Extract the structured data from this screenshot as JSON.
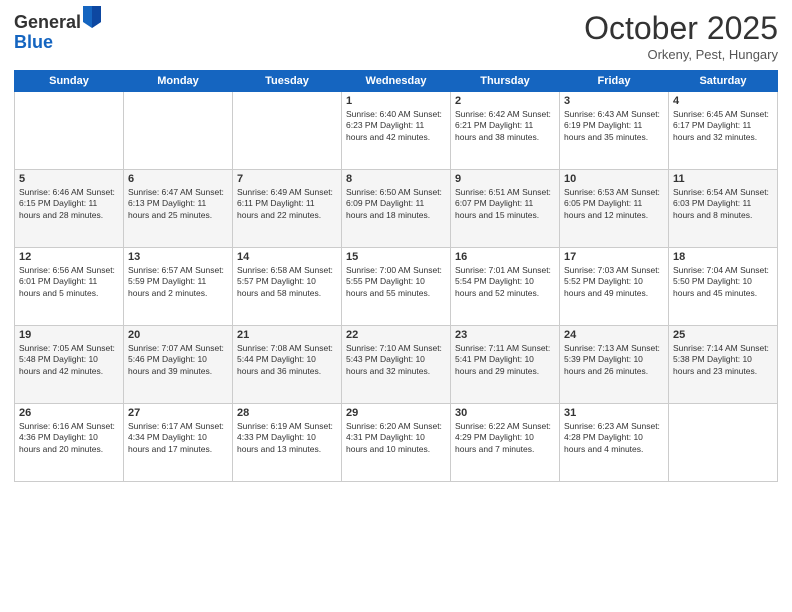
{
  "header": {
    "logo_general": "General",
    "logo_blue": "Blue",
    "month": "October 2025",
    "location": "Orkeny, Pest, Hungary"
  },
  "weekdays": [
    "Sunday",
    "Monday",
    "Tuesday",
    "Wednesday",
    "Thursday",
    "Friday",
    "Saturday"
  ],
  "weeks": [
    [
      {
        "day": "",
        "info": ""
      },
      {
        "day": "",
        "info": ""
      },
      {
        "day": "",
        "info": ""
      },
      {
        "day": "1",
        "info": "Sunrise: 6:40 AM\nSunset: 6:23 PM\nDaylight: 11 hours\nand 42 minutes."
      },
      {
        "day": "2",
        "info": "Sunrise: 6:42 AM\nSunset: 6:21 PM\nDaylight: 11 hours\nand 38 minutes."
      },
      {
        "day": "3",
        "info": "Sunrise: 6:43 AM\nSunset: 6:19 PM\nDaylight: 11 hours\nand 35 minutes."
      },
      {
        "day": "4",
        "info": "Sunrise: 6:45 AM\nSunset: 6:17 PM\nDaylight: 11 hours\nand 32 minutes."
      }
    ],
    [
      {
        "day": "5",
        "info": "Sunrise: 6:46 AM\nSunset: 6:15 PM\nDaylight: 11 hours\nand 28 minutes."
      },
      {
        "day": "6",
        "info": "Sunrise: 6:47 AM\nSunset: 6:13 PM\nDaylight: 11 hours\nand 25 minutes."
      },
      {
        "day": "7",
        "info": "Sunrise: 6:49 AM\nSunset: 6:11 PM\nDaylight: 11 hours\nand 22 minutes."
      },
      {
        "day": "8",
        "info": "Sunrise: 6:50 AM\nSunset: 6:09 PM\nDaylight: 11 hours\nand 18 minutes."
      },
      {
        "day": "9",
        "info": "Sunrise: 6:51 AM\nSunset: 6:07 PM\nDaylight: 11 hours\nand 15 minutes."
      },
      {
        "day": "10",
        "info": "Sunrise: 6:53 AM\nSunset: 6:05 PM\nDaylight: 11 hours\nand 12 minutes."
      },
      {
        "day": "11",
        "info": "Sunrise: 6:54 AM\nSunset: 6:03 PM\nDaylight: 11 hours\nand 8 minutes."
      }
    ],
    [
      {
        "day": "12",
        "info": "Sunrise: 6:56 AM\nSunset: 6:01 PM\nDaylight: 11 hours\nand 5 minutes."
      },
      {
        "day": "13",
        "info": "Sunrise: 6:57 AM\nSunset: 5:59 PM\nDaylight: 11 hours\nand 2 minutes."
      },
      {
        "day": "14",
        "info": "Sunrise: 6:58 AM\nSunset: 5:57 PM\nDaylight: 10 hours\nand 58 minutes."
      },
      {
        "day": "15",
        "info": "Sunrise: 7:00 AM\nSunset: 5:55 PM\nDaylight: 10 hours\nand 55 minutes."
      },
      {
        "day": "16",
        "info": "Sunrise: 7:01 AM\nSunset: 5:54 PM\nDaylight: 10 hours\nand 52 minutes."
      },
      {
        "day": "17",
        "info": "Sunrise: 7:03 AM\nSunset: 5:52 PM\nDaylight: 10 hours\nand 49 minutes."
      },
      {
        "day": "18",
        "info": "Sunrise: 7:04 AM\nSunset: 5:50 PM\nDaylight: 10 hours\nand 45 minutes."
      }
    ],
    [
      {
        "day": "19",
        "info": "Sunrise: 7:05 AM\nSunset: 5:48 PM\nDaylight: 10 hours\nand 42 minutes."
      },
      {
        "day": "20",
        "info": "Sunrise: 7:07 AM\nSunset: 5:46 PM\nDaylight: 10 hours\nand 39 minutes."
      },
      {
        "day": "21",
        "info": "Sunrise: 7:08 AM\nSunset: 5:44 PM\nDaylight: 10 hours\nand 36 minutes."
      },
      {
        "day": "22",
        "info": "Sunrise: 7:10 AM\nSunset: 5:43 PM\nDaylight: 10 hours\nand 32 minutes."
      },
      {
        "day": "23",
        "info": "Sunrise: 7:11 AM\nSunset: 5:41 PM\nDaylight: 10 hours\nand 29 minutes."
      },
      {
        "day": "24",
        "info": "Sunrise: 7:13 AM\nSunset: 5:39 PM\nDaylight: 10 hours\nand 26 minutes."
      },
      {
        "day": "25",
        "info": "Sunrise: 7:14 AM\nSunset: 5:38 PM\nDaylight: 10 hours\nand 23 minutes."
      }
    ],
    [
      {
        "day": "26",
        "info": "Sunrise: 6:16 AM\nSunset: 4:36 PM\nDaylight: 10 hours\nand 20 minutes."
      },
      {
        "day": "27",
        "info": "Sunrise: 6:17 AM\nSunset: 4:34 PM\nDaylight: 10 hours\nand 17 minutes."
      },
      {
        "day": "28",
        "info": "Sunrise: 6:19 AM\nSunset: 4:33 PM\nDaylight: 10 hours\nand 13 minutes."
      },
      {
        "day": "29",
        "info": "Sunrise: 6:20 AM\nSunset: 4:31 PM\nDaylight: 10 hours\nand 10 minutes."
      },
      {
        "day": "30",
        "info": "Sunrise: 6:22 AM\nSunset: 4:29 PM\nDaylight: 10 hours\nand 7 minutes."
      },
      {
        "day": "31",
        "info": "Sunrise: 6:23 AM\nSunset: 4:28 PM\nDaylight: 10 hours\nand 4 minutes."
      },
      {
        "day": "",
        "info": ""
      }
    ]
  ]
}
